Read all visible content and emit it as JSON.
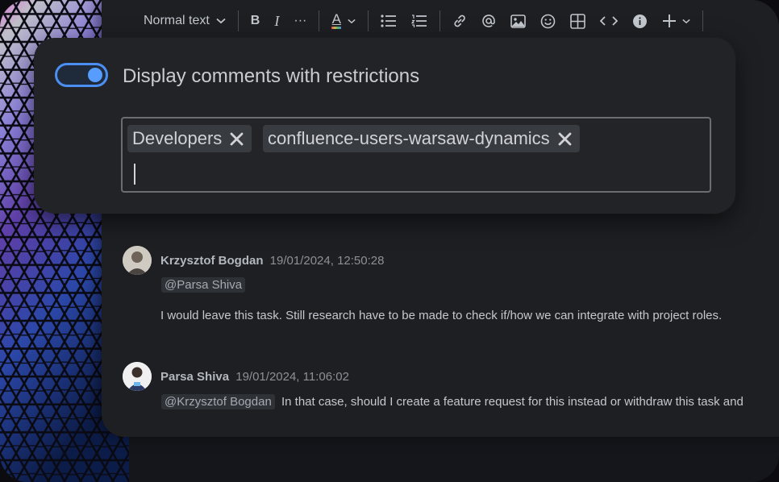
{
  "toolbar": {
    "text_style": "Normal text",
    "bold": "B",
    "italic": "I",
    "more": "···",
    "text_color_label": "A"
  },
  "restrictions_popup": {
    "toggle_label": "Display comments with restrictions",
    "toggle_on": true,
    "tags": [
      "Developers",
      "confluence-users-warsaw-dynamics"
    ]
  },
  "comments": [
    {
      "author": "Krzysztof Bogdan",
      "timestamp": "19/01/2024, 12:50:28",
      "mention": "@Parsa Shiva",
      "text": "I would leave this task. Still research have to be made to check if/how we can integrate with project roles."
    },
    {
      "author": "Parsa Shiva",
      "timestamp": "19/01/2024, 11:06:02",
      "mention": "@Krzysztof Bogdan",
      "text": "In that case, should I create a feature request for this instead or withdraw this task and"
    }
  ],
  "colors": {
    "accent": "#579dff",
    "panel": "#212326",
    "editor": "#1d1f22"
  }
}
